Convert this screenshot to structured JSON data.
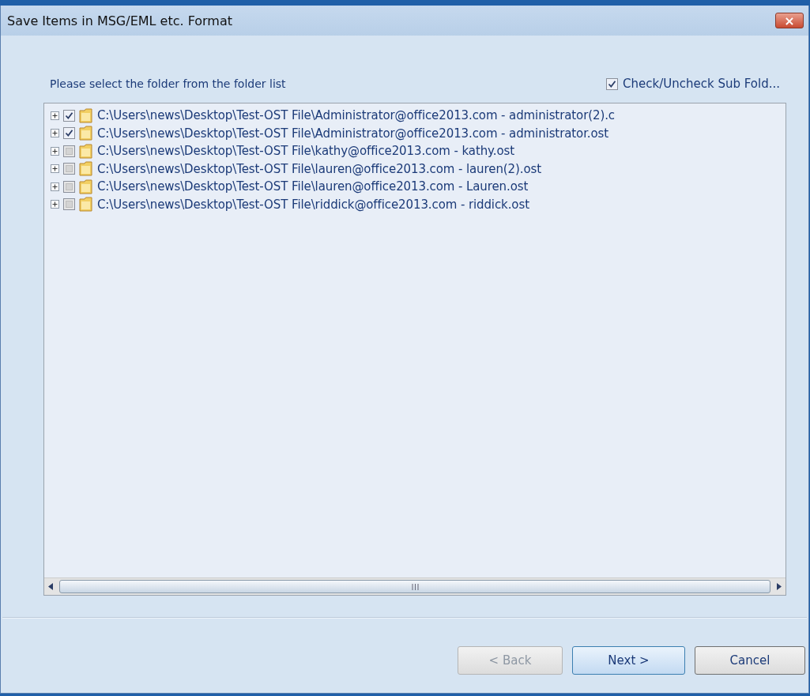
{
  "window": {
    "title": "Save Items in MSG/EML etc. Format",
    "close": "×"
  },
  "instruction": "Please select the folder from the folder list",
  "subfolder_toggle": {
    "label": "Check/Uncheck Sub Fold...",
    "checked": true
  },
  "folder_tree": [
    {
      "path": "C:\\Users\\news\\Desktop\\Test-OST File\\Administrator@office2013.com - administrator(2).c",
      "checked": true,
      "expanded": false
    },
    {
      "path": "C:\\Users\\news\\Desktop\\Test-OST File\\Administrator@office2013.com - administrator.ost",
      "checked": true,
      "expanded": false
    },
    {
      "path": "C:\\Users\\news\\Desktop\\Test-OST File\\kathy@office2013.com - kathy.ost",
      "checked": false,
      "expanded": false
    },
    {
      "path": "C:\\Users\\news\\Desktop\\Test-OST File\\lauren@office2013.com - lauren(2).ost",
      "checked": false,
      "expanded": false
    },
    {
      "path": "C:\\Users\\news\\Desktop\\Test-OST File\\lauren@office2013.com - Lauren.ost",
      "checked": false,
      "expanded": false
    },
    {
      "path": "C:\\Users\\news\\Desktop\\Test-OST File\\riddick@office2013.com - riddick.ost",
      "checked": false,
      "expanded": false
    }
  ],
  "buttons": [
    {
      "label": "< Back",
      "disabled": true
    },
    {
      "label": "Next >",
      "disabled": false
    },
    {
      "label": "Cancel",
      "disabled": false
    }
  ]
}
